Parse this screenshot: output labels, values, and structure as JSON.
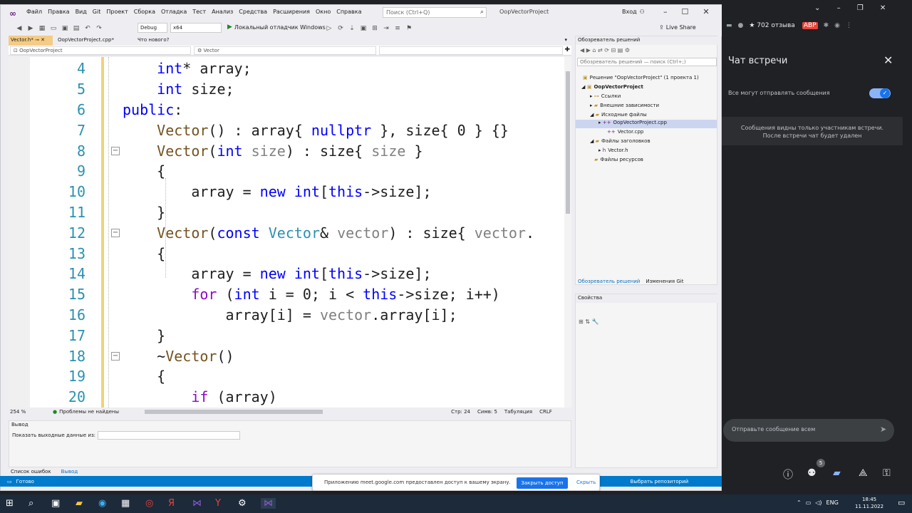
{
  "menubar": {
    "items": [
      "Файл",
      "Правка",
      "Вид",
      "Git",
      "Проект",
      "Сборка",
      "Отладка",
      "Тест",
      "Анализ",
      "Средства",
      "Расширения",
      "Окно",
      "Справка"
    ],
    "search_placeholder": "Поиск (Ctrl+Q)",
    "project": "OopVectorProject",
    "login": "Вход"
  },
  "toolbar": {
    "config": "Debug",
    "platform": "x64",
    "run": "Локальный отладчик Windows",
    "liveshare": "Live Share"
  },
  "tabs": [
    {
      "label": "Vector.h*"
    },
    {
      "label": "OopVectorProject.cpp*"
    },
    {
      "label": "Что нового?"
    }
  ],
  "nav": {
    "project": "OopVectorProject",
    "scope": "Vector"
  },
  "code": {
    "lines": [
      "4",
      "5",
      "6",
      "7",
      "8",
      "9",
      "10",
      "11",
      "12",
      "13",
      "14",
      "15",
      "16",
      "17",
      "18",
      "19",
      "20"
    ]
  },
  "editor_status": {
    "zoom": "254 %",
    "issues": "Проблемы не найдены",
    "line": "Стр: 24",
    "col": "Симв: 5",
    "tabs": "Табуляция",
    "eol": "CRLF"
  },
  "solution": {
    "title": "Обозреватель решений",
    "search": "Обозреватель решений — поиск (Ctrl+;)",
    "solution_node": "Решение \"OopVectorProject\" (1 проекта 1)",
    "project_node": "OopVectorProject",
    "refs": "Ссылки",
    "external": "Внешние зависимости",
    "sources": "Исходные файлы",
    "file_main": "OopVectorProject.cpp",
    "file_vec": "Vector.cpp",
    "headers": "Файлы заголовков",
    "file_h": "Vector.h",
    "resources": "Файлы ресурсов",
    "tab1": "Обозреватель решений",
    "tab2": "Изменения Git"
  },
  "properties": {
    "title": "Свойства"
  },
  "output": {
    "title": "Вывод",
    "show_from": "Показать выходные данные из:"
  },
  "bottom_tabs": {
    "errors": "Список ошибок",
    "output": "Вывод"
  },
  "vs_status": {
    "ready": "Готово",
    "repo": "Выбрать репозиторий"
  },
  "meet_popup": {
    "message": "Приложению meet.google.com предоставлен доступ к вашему экрану.",
    "stop": "Закрыть доступ",
    "hide": "Скрыть"
  },
  "chrome": {
    "rating": "★ 702 отзыва"
  },
  "chat": {
    "title": "Чат встречи",
    "toggle_label": "Все могут отправлять сообщения",
    "info_line1": "Сообщения видны только участникам встречи.",
    "info_line2": "После встречи чат будет удален",
    "input_placeholder": "Отправьте сообщение всем",
    "participants_badge": "5"
  },
  "taskbar": {
    "lang": "ENG",
    "time": "18:45",
    "date": "11.11.2022"
  }
}
